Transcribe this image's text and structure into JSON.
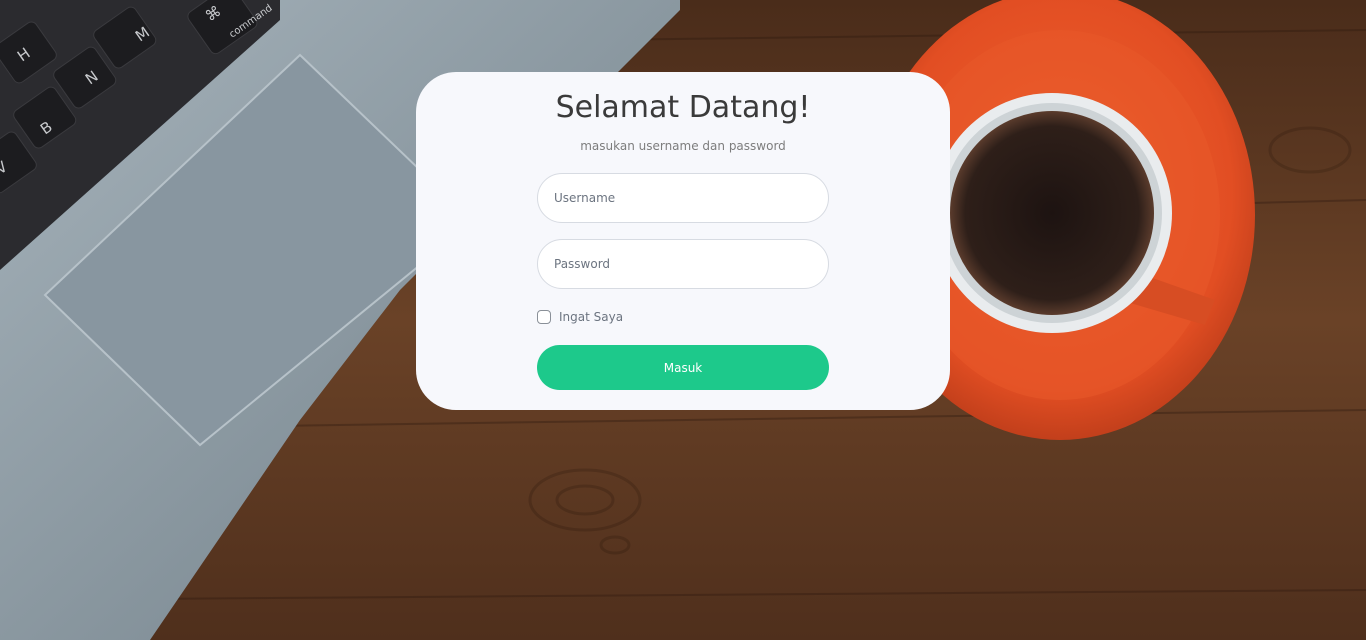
{
  "login": {
    "title": "Selamat Datang!",
    "subtitle": "masukan username dan password",
    "username": {
      "placeholder": "Username",
      "value": ""
    },
    "password": {
      "placeholder": "Password",
      "value": ""
    },
    "remember": {
      "label": "Ingat Saya",
      "checked": false
    },
    "submit_label": "Masuk"
  },
  "background": {
    "keyboard_keys": [
      "H",
      "N",
      "M",
      "B",
      "V",
      "⌘",
      "command"
    ]
  },
  "colors": {
    "card": "#f7f8fc",
    "button": "#1dc98b",
    "wood": "#5e3a22",
    "laptop": "#8e9ca6",
    "saucer": "#e5542a",
    "coffee": "#2a1d18"
  },
  "icons": [
    "checkbox-icon"
  ]
}
